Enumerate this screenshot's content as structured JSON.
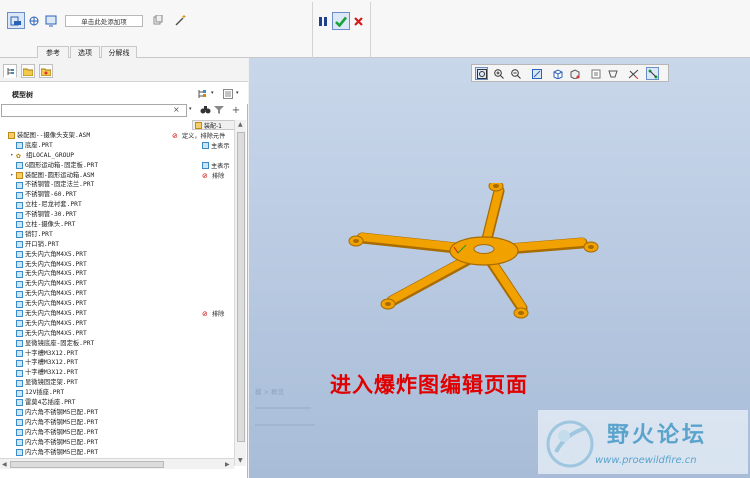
{
  "ribbon": {
    "add_item_label": "单击此处添加项",
    "tabs": [
      "参考",
      "选项",
      "分解线"
    ],
    "colors": {
      "pause": "#1f3f8f",
      "confirm": "#19a33a",
      "cancel": "#d21c1c"
    }
  },
  "left_panel": {
    "tree_title": "模型树",
    "search": {
      "value": "",
      "clear_label": "×"
    },
    "column_header": "装配-1",
    "items": [
      {
        "label": "装配图--摄像头支架.ASM",
        "icon": "assembly-icon",
        "expand": ""
      },
      {
        "label": "底座.PRT",
        "icon": "part-icon",
        "expand": ""
      },
      {
        "label": "组LOCAL_GROUP",
        "icon": "group-icon",
        "expand": "▸"
      },
      {
        "label": "G圆形运动箱-固定板.PRT",
        "icon": "part-icon",
        "expand": ""
      },
      {
        "label": "装配图-圆形运动箱.ASM",
        "icon": "assembly-icon",
        "expand": "▸"
      },
      {
        "label": "不锈钢管-固定法兰.PRT",
        "icon": "part-icon",
        "expand": ""
      },
      {
        "label": "不锈钢管-60.PRT",
        "icon": "part-icon",
        "expand": ""
      },
      {
        "label": "立柱-尼龙衬套.PRT",
        "icon": "part-icon",
        "expand": ""
      },
      {
        "label": "不锈钢管-30.PRT",
        "icon": "part-icon",
        "expand": ""
      },
      {
        "label": "立柱-摄像头.PRT",
        "icon": "part-icon",
        "expand": ""
      },
      {
        "label": "销钉.PRT",
        "icon": "part-icon",
        "expand": ""
      },
      {
        "label": "开口销.PRT",
        "icon": "part-icon",
        "expand": ""
      },
      {
        "label": "无头内六角M4X5.PRT",
        "icon": "part-icon",
        "expand": ""
      },
      {
        "label": "无头内六角M4X5.PRT",
        "icon": "part-icon",
        "expand": ""
      },
      {
        "label": "无头内六角M4X5.PRT",
        "icon": "part-icon",
        "expand": ""
      },
      {
        "label": "无头内六角M4X5.PRT",
        "icon": "part-icon",
        "expand": ""
      },
      {
        "label": "无头内六角M4X5.PRT",
        "icon": "part-icon",
        "expand": ""
      },
      {
        "label": "无头内六角M4X5.PRT",
        "icon": "part-icon",
        "expand": ""
      },
      {
        "label": "无头内六角M4X5.PRT",
        "icon": "part-icon",
        "expand": ""
      },
      {
        "label": "无头内六角M4X5.PRT",
        "icon": "part-icon",
        "expand": ""
      },
      {
        "label": "无头内六角M4X5.PRT",
        "icon": "part-icon",
        "expand": ""
      },
      {
        "label": "显微镜底座-固定板.PRT",
        "icon": "part-icon",
        "expand": ""
      },
      {
        "label": "十字槽M3X12.PRT",
        "icon": "part-icon",
        "expand": ""
      },
      {
        "label": "十字槽M3X12.PRT",
        "icon": "part-icon",
        "expand": ""
      },
      {
        "label": "十字槽M3X12.PRT",
        "icon": "part-icon",
        "expand": ""
      },
      {
        "label": "显微镜固定架.PRT",
        "icon": "part-icon",
        "expand": ""
      },
      {
        "label": "12V插座.PRT",
        "icon": "part-icon",
        "expand": ""
      },
      {
        "label": "雷莫4芯插座.PRT",
        "icon": "part-icon",
        "expand": ""
      },
      {
        "label": "内六角不锈钢M5已配.PRT",
        "icon": "part-icon",
        "expand": ""
      },
      {
        "label": "内六角不锈钢M5已配.PRT",
        "icon": "part-icon",
        "expand": ""
      },
      {
        "label": "内六角不锈钢M5已配.PRT",
        "icon": "part-icon",
        "expand": ""
      },
      {
        "label": "内六角不锈钢M5已配.PRT",
        "icon": "part-icon",
        "expand": ""
      },
      {
        "label": "内六角不锈钢M5已配.PRT",
        "icon": "part-icon",
        "expand": ""
      }
    ],
    "status_cells": [
      {
        "row": 0,
        "label": "定义，排除元件",
        "icon": "exclude-icon"
      },
      {
        "row": 1,
        "label": "主表示",
        "icon": "part-icon"
      },
      {
        "row": 3,
        "label": "主表示",
        "icon": "part-icon"
      },
      {
        "row": 4,
        "label": "排除",
        "icon": "exclude-icon"
      },
      {
        "row": 18,
        "label": "排除",
        "icon": "exclude-icon"
      }
    ]
  },
  "viewport": {
    "caption": "进入爆炸图编辑页面",
    "faint_label": "模 > 概览",
    "model_color": "#f2a200",
    "watermark": {
      "name": "野火论坛",
      "url": "www.proewildfire.cn"
    }
  }
}
